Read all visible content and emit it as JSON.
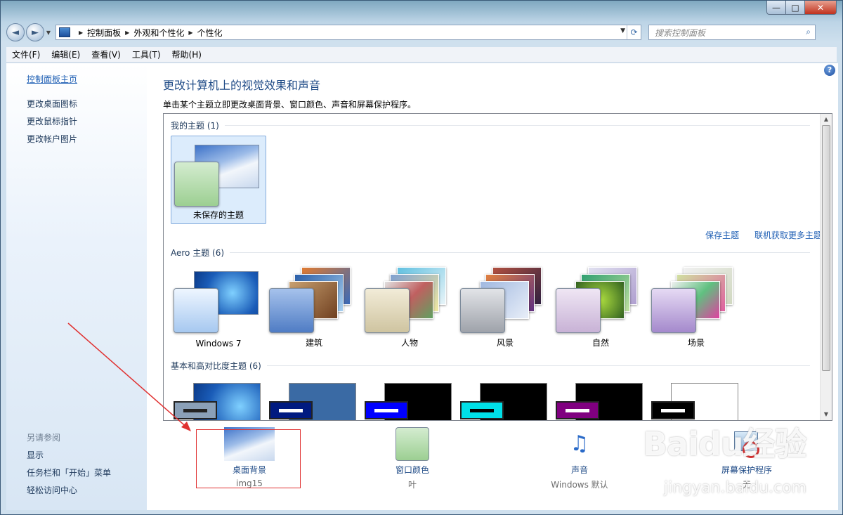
{
  "window": {
    "min": "—",
    "max": "□",
    "close": "✕"
  },
  "nav": {
    "back": "◄",
    "forward": "►",
    "dropdown": "▼",
    "refresh": "⟳"
  },
  "breadcrumb": [
    "控制面板",
    "外观和个性化",
    "个性化"
  ],
  "search": {
    "placeholder": "搜索控制面板",
    "icon": "⌕"
  },
  "menu": [
    "文件(F)",
    "编辑(E)",
    "查看(V)",
    "工具(T)",
    "帮助(H)"
  ],
  "sidebar": {
    "home": "控制面板主页",
    "items": [
      "更改桌面图标",
      "更改鼠标指针",
      "更改帐户图片"
    ],
    "see_also_title": "另请参阅",
    "see_also": [
      "显示",
      "任务栏和「开始」菜单",
      "轻松访问中心"
    ]
  },
  "main": {
    "help": "?",
    "title": "更改计算机上的视觉效果和声音",
    "subtitle": "单击某个主题立即更改桌面背景、窗口颜色、声音和屏幕保护程序。",
    "my_themes": {
      "header": "我的主题 (1)",
      "items": [
        {
          "label": "未保存的主题"
        }
      ]
    },
    "links": {
      "save": "保存主题",
      "online": "联机获取更多主题"
    },
    "aero": {
      "header": "Aero 主题 (6)",
      "items": [
        "Windows 7",
        "建筑",
        "人物",
        "风景",
        "自然",
        "场景"
      ],
      "colors": [
        "#3d8be0",
        "#3f7fc8",
        "#d8cfb4",
        "#b0b4bc",
        "#c7d9a2",
        "#9a80c8"
      ]
    },
    "basic": {
      "header": "基本和高对比度主题 (6)",
      "bg_colors": [
        "#2f78cc",
        "#3a6aa4",
        "#000000",
        "#000000",
        "#000000",
        "#ffffff"
      ],
      "bar_colors": [
        "#8aa0b8",
        "#001a80",
        "#0000ff",
        "#00e0e8",
        "#800080",
        "#000000"
      ],
      "line_colors": [
        "#222222",
        "#ffffff",
        "#ffffff",
        "#000000",
        "#ffffff",
        "#ffffff"
      ]
    }
  },
  "bottom": [
    {
      "label": "桌面背景",
      "value": "img15"
    },
    {
      "label": "窗口颜色",
      "value": "叶"
    },
    {
      "label": "声音",
      "value": "Windows 默认"
    },
    {
      "label": "屏幕保护程序",
      "value": "无"
    }
  ],
  "watermark": {
    "brand": "Baidu经验",
    "url": "jingyan.baidu.com"
  },
  "accent": "#1e4a86",
  "highlight": "#e03030"
}
